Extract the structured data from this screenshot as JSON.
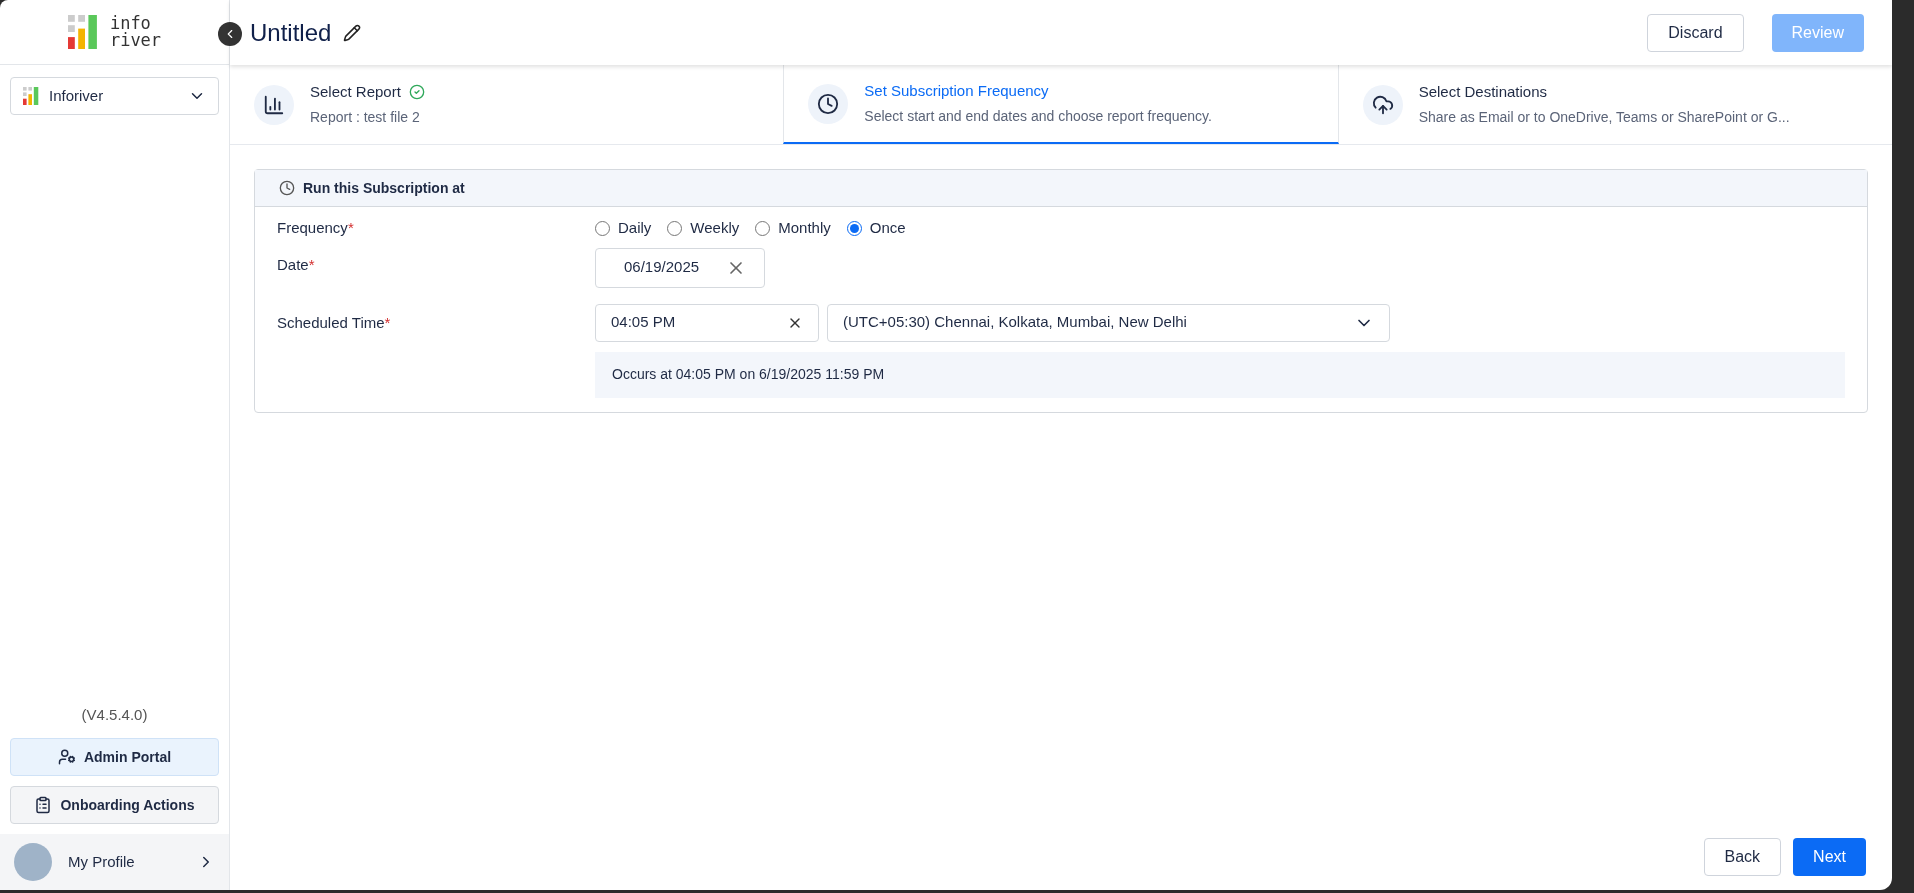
{
  "sidebar": {
    "logo": {
      "line_1": "info",
      "line_2": "river"
    },
    "workspace": "Inforiver",
    "version": "(V4.5.4.0)",
    "buttons": [
      {
        "kind": "admin",
        "label": "Admin Portal",
        "selected": true
      },
      {
        "kind": "onboarding",
        "label": "Onboarding Actions",
        "selected": false
      }
    ],
    "profile": "My Profile"
  },
  "header": {
    "title": "Untitled",
    "buttons": [
      {
        "label": "Discard",
        "disabled": false,
        "kind": "outline"
      },
      {
        "label": "Review",
        "disabled": true,
        "kind": "primary"
      }
    ]
  },
  "steps": [
    {
      "kind": "report",
      "title": "Select Report",
      "subtitle": "Report : test file 2",
      "done": true,
      "selected": false
    },
    {
      "kind": "clock",
      "title": "Set Subscription Frequency",
      "subtitle": "Select start and end dates and choose report frequency.",
      "done": false,
      "selected": true
    },
    {
      "kind": "cloud",
      "title": "Select Destinations",
      "subtitle": "Share as Email or to OneDrive, Teams or SharePoint or G...",
      "done": false,
      "selected": false
    }
  ],
  "panel": {
    "title": "Run this Subscription at",
    "frequency": {
      "label": "Frequency",
      "required_mark": "*",
      "options": [
        {
          "label": "Daily",
          "selected": false
        },
        {
          "label": "Weekly",
          "selected": false
        },
        {
          "label": "Monthly",
          "selected": false
        },
        {
          "label": "Once",
          "selected": true
        }
      ]
    },
    "date": {
      "label": "Date",
      "required_mark": "*",
      "value": "06/19/2025"
    },
    "time": {
      "label": "Scheduled Time",
      "required_mark": "*",
      "value": "04:05 PM",
      "timezone": "(UTC+05:30) Chennai, Kolkata, Mumbai, New Delhi"
    },
    "summary": "Occurs at 04:05 PM on 6/19/2025 11:59 PM"
  },
  "footer": [
    {
      "label": "Back",
      "kind": "outline"
    },
    {
      "label": "Next",
      "kind": "primary"
    }
  ]
}
